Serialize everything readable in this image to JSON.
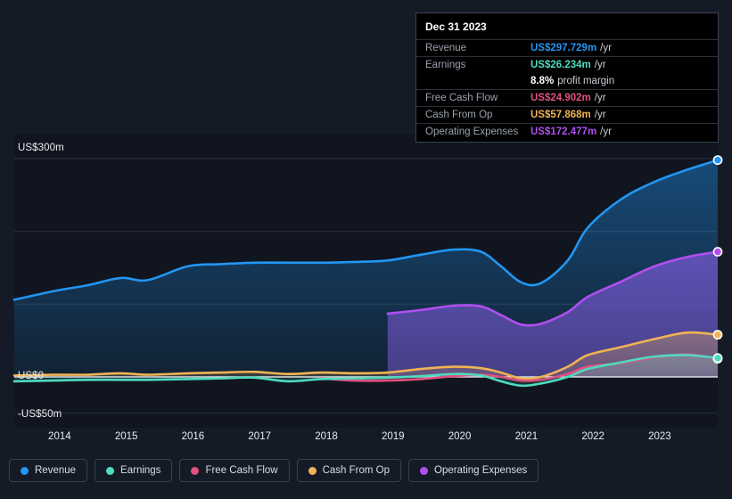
{
  "chart_data": {
    "type": "area",
    "title": "",
    "xlabel": "",
    "ylabel": "",
    "grid": true,
    "legend_position": "bottom",
    "ylim": [
      -50,
      300
    ],
    "y_unit": "US$m",
    "y_ticks": [
      {
        "label": "US$300m",
        "value": 300
      },
      {
        "label": "US$0",
        "value": 0
      },
      {
        "label": "-US$50m",
        "value": -50
      }
    ],
    "gridlines": [
      300,
      200,
      100,
      0,
      -50
    ],
    "x_ticks": [
      "2014",
      "2015",
      "2016",
      "2017",
      "2018",
      "2019",
      "2020",
      "2021",
      "2022",
      "2023"
    ],
    "xlim": [
      "2013.4",
      "2023.95"
    ],
    "x": [
      2013.4,
      2014,
      2014.5,
      2015,
      2015.4,
      2016,
      2016.5,
      2017,
      2017.5,
      2018,
      2018.5,
      2019,
      2019.5,
      2020,
      2020.4,
      2020.7,
      2021,
      2021.3,
      2021.7,
      2022,
      2022.5,
      2023,
      2023.5,
      2023.95
    ],
    "series": [
      {
        "name": "Revenue",
        "color": "#2196f3",
        "unit": "US$m",
        "values": [
          106,
          118,
          126,
          136,
          133,
          152,
          155,
          157,
          157,
          157,
          158,
          160,
          168,
          175,
          172,
          152,
          130,
          129,
          160,
          205,
          244,
          268,
          285,
          298
        ]
      },
      {
        "name": "Earnings",
        "color": "#4edbc0",
        "unit": "US$m",
        "values": [
          -6,
          -5,
          -4,
          -4,
          -4,
          -3,
          -2,
          -1,
          -6,
          -3,
          -2,
          -1,
          1,
          4,
          2,
          -6,
          -12,
          -9,
          0,
          11,
          20,
          28,
          30,
          26
        ]
      },
      {
        "name": "Free Cash Flow",
        "color": "#e05080",
        "unit": "US$m",
        "values": [
          null,
          null,
          null,
          null,
          null,
          null,
          null,
          null,
          null,
          -2,
          -5,
          -5,
          -3,
          1,
          3,
          0,
          -5,
          -4,
          4,
          14,
          19,
          27,
          31,
          25
        ]
      },
      {
        "name": "Cash From Op",
        "color": "#f0b355",
        "unit": "US$m",
        "values": [
          2,
          3,
          3,
          5,
          3,
          5,
          6,
          7,
          4,
          6,
          5,
          6,
          11,
          14,
          12,
          6,
          -2,
          0,
          14,
          30,
          41,
          52,
          61,
          58
        ]
      },
      {
        "name": "Operating Expenses",
        "color": "#b04ef0",
        "unit": "US$m",
        "values": [
          null,
          null,
          null,
          null,
          null,
          null,
          null,
          null,
          null,
          null,
          null,
          87,
          92,
          98,
          97,
          85,
          72,
          73,
          89,
          110,
          131,
          152,
          165,
          172
        ]
      }
    ],
    "endpoint_markers": [
      {
        "series": "Revenue",
        "value": 298
      },
      {
        "series": "Operating Expenses",
        "value": 172
      },
      {
        "series": "Cash From Op",
        "value": 58
      },
      {
        "series": "Free Cash Flow",
        "value": 25
      },
      {
        "series": "Earnings",
        "value": 26
      }
    ]
  },
  "tooltip": {
    "date": "Dec 31 2023",
    "rows": [
      {
        "label": "Revenue",
        "value": "US$297.729m",
        "unit": "/yr",
        "color": "#2196f3"
      },
      {
        "label": "Earnings",
        "value": "US$26.234m",
        "unit": "/yr",
        "color": "#4edbc0"
      },
      {
        "label": "",
        "value": "8.8%",
        "unit": "profit margin",
        "color": "#ffffff",
        "sub": true
      },
      {
        "label": "Free Cash Flow",
        "value": "US$24.902m",
        "unit": "/yr",
        "color": "#e05080"
      },
      {
        "label": "Cash From Op",
        "value": "US$57.868m",
        "unit": "/yr",
        "color": "#f0b355"
      },
      {
        "label": "Operating Expenses",
        "value": "US$172.477m",
        "unit": "/yr",
        "color": "#b04ef0"
      }
    ]
  },
  "legend": {
    "items": [
      {
        "label": "Revenue",
        "color": "#2196f3"
      },
      {
        "label": "Earnings",
        "color": "#4edbc0"
      },
      {
        "label": "Free Cash Flow",
        "color": "#e05080"
      },
      {
        "label": "Cash From Op",
        "color": "#f0b355"
      },
      {
        "label": "Operating Expenses",
        "color": "#b04ef0"
      }
    ]
  },
  "colors": {
    "background": "#151b26",
    "plot_background": "#10151f",
    "grid": "#2a3140",
    "zero_line": "#e9edf2",
    "axis_text": "#e9edf2"
  }
}
